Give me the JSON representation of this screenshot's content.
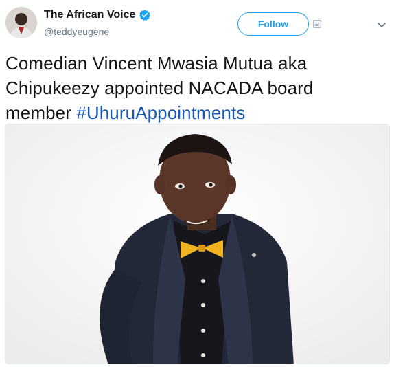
{
  "user": {
    "display_name": "The African Voice",
    "handle": "@teddyeugene",
    "verified": true,
    "avatar_icon": "profile-avatar"
  },
  "actions": {
    "follow_label": "Follow",
    "caret_icon": "chevron-down-icon"
  },
  "tweet": {
    "text_line1": "Comedian Vincent Mwasia Mutua aka",
    "text_line2": "Chipukeezy appointed NACADA board",
    "text_line3_prefix": "member ",
    "hashtag": "#UhuruAppointments"
  },
  "media": {
    "icon": "photo-of-man-in-suit-with-yellow-bow-tie"
  },
  "colors": {
    "accent": "#1da1f2",
    "hashtag": "#1b5bb8",
    "text": "#14171a",
    "muted": "#657786",
    "bowtie": "#f2b320"
  }
}
